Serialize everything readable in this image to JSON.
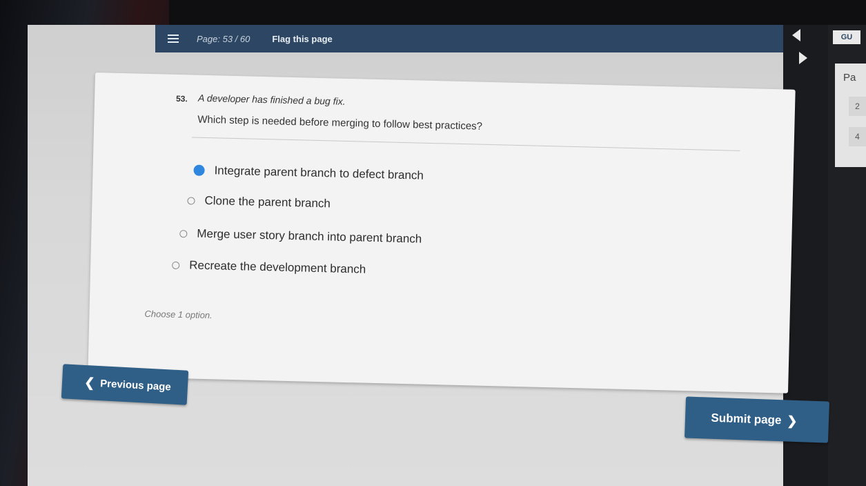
{
  "topbar": {
    "page_indicator": "Page: 53 / 60",
    "flag_label": "Flag this page",
    "menu_icon": "hamburger-icon"
  },
  "side_panel": {
    "logo_text": "GU",
    "heading": "Pa",
    "cells": [
      "2",
      "4"
    ],
    "icons": [
      "collapse-left-icon",
      "collapse-right-icon"
    ]
  },
  "question": {
    "number": "53.",
    "stem": "A developer has finished a bug fix.",
    "prompt": "Which step is needed before merging to follow best practices?",
    "options": [
      {
        "label": "Integrate parent branch to defect branch",
        "selected": true
      },
      {
        "label": "Clone the parent branch",
        "selected": false
      },
      {
        "label": "Merge user story branch into parent branch",
        "selected": false
      },
      {
        "label": "Recreate the development branch",
        "selected": false
      }
    ],
    "hint": "Choose 1 option."
  },
  "nav": {
    "previous_label": "Previous page",
    "submit_label": "Submit page"
  },
  "colors": {
    "topbar": "#2c4663",
    "button": "#2f5f86",
    "selected_radio": "#2e86de"
  }
}
